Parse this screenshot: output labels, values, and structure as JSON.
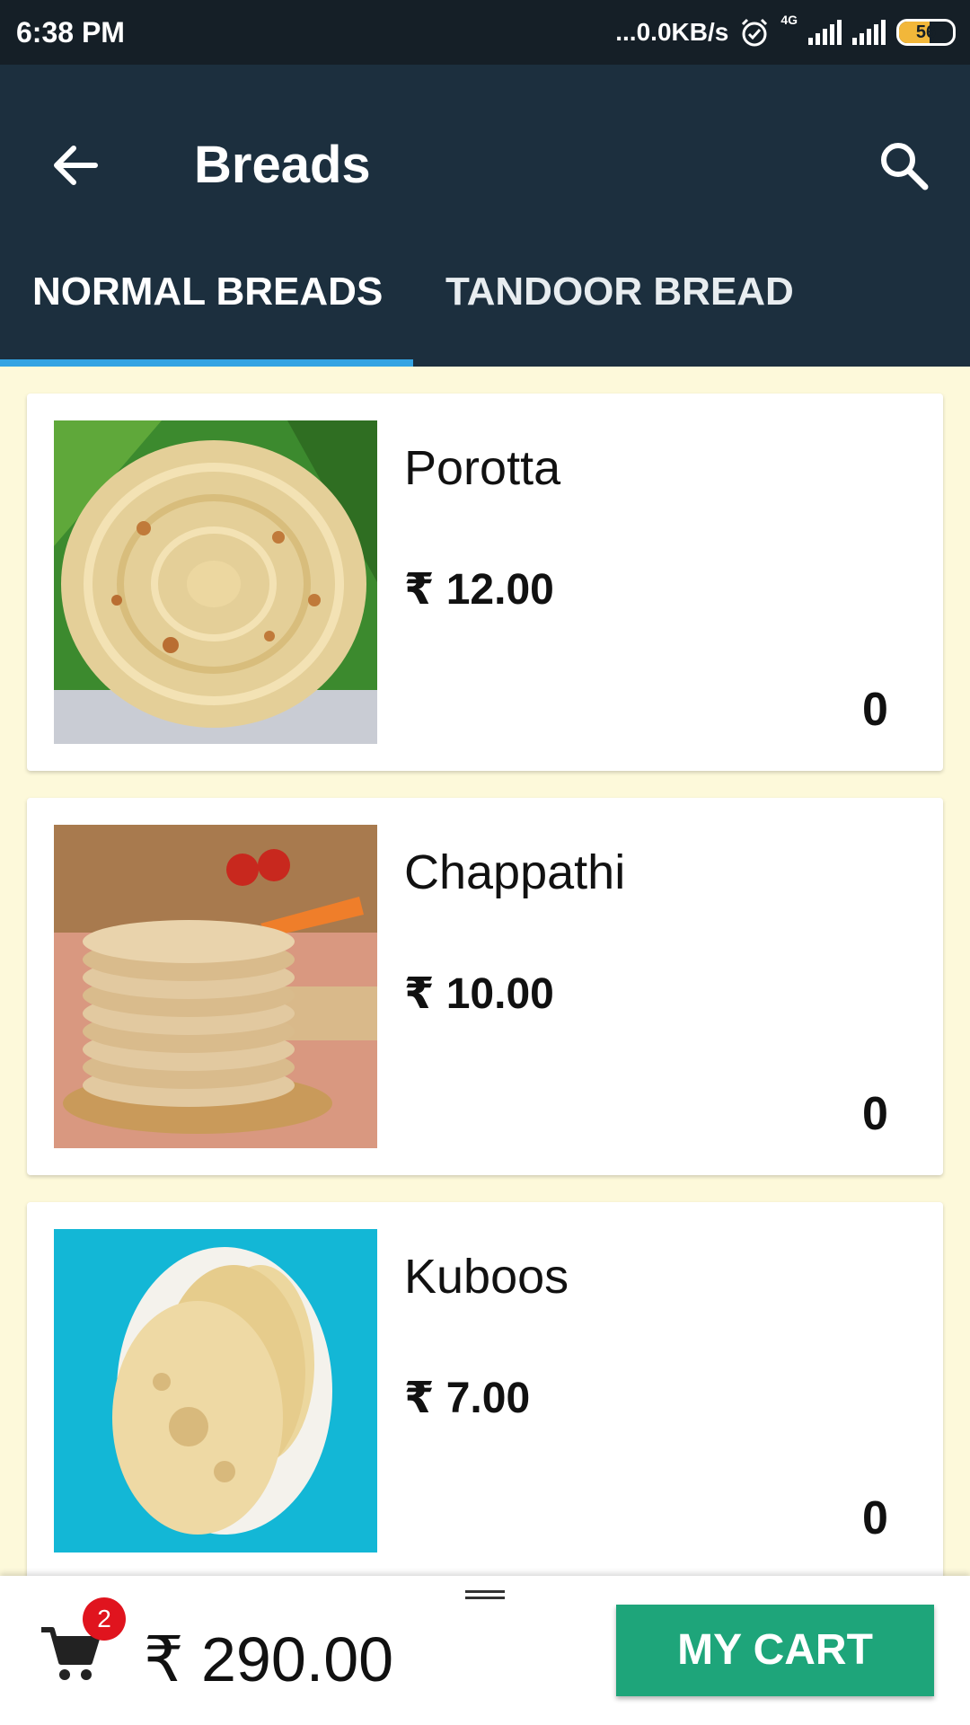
{
  "status_bar": {
    "time": "6:38 PM",
    "network_speed": "...0.0KB/s",
    "network_type": "4G",
    "battery_level": "56"
  },
  "app_bar": {
    "title": "Breads",
    "back_icon": "arrow-left-icon",
    "search_icon": "search-icon"
  },
  "tabs": [
    {
      "label": "NORMAL BREADS",
      "selected": true
    },
    {
      "label": "TANDOOR BREAD",
      "selected": false
    }
  ],
  "colors": {
    "app_bar": "#1c2f3e",
    "status_bar": "#151f27",
    "tab_indicator": "#33a4e3",
    "page_background": "#fdf9da",
    "cart_button": "#1ea57a",
    "badge": "#e0141e"
  },
  "items": [
    {
      "name": "Porotta",
      "price": "₹ 12.00",
      "quantity": "0",
      "image": "porotta-photo"
    },
    {
      "name": "Chappathi",
      "price": "₹ 10.00",
      "quantity": "0",
      "image": "chappathi-photo"
    },
    {
      "name": "Kuboos",
      "price": "₹ 7.00",
      "quantity": "0",
      "image": "kuboos-photo"
    }
  ],
  "cart": {
    "badge_count": "2",
    "total": "₹ 290.00",
    "button_label": "MY CART",
    "cart_icon": "shopping-cart-icon"
  }
}
